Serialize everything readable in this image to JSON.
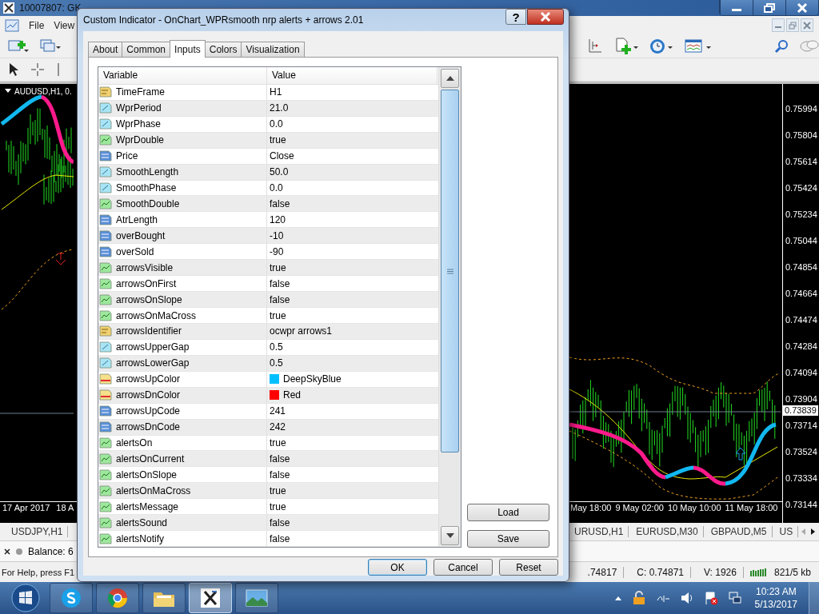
{
  "app_window": {
    "title": "10007807: GK",
    "menu": [
      "File",
      "View"
    ]
  },
  "left_chart": {
    "label": "AUDUSD,H1, 0.",
    "time_labels": [
      "17 Apr 2017",
      "18 A"
    ]
  },
  "right_chart": {
    "price_labels": [
      "0.75994",
      "0.75804",
      "0.75614",
      "0.75424",
      "0.75234",
      "0.75044",
      "0.74854",
      "0.74664",
      "0.74474",
      "0.74284",
      "0.74094",
      "0.73904",
      "0.73714",
      "0.73524",
      "0.73334",
      "0.73144"
    ],
    "current_price": "0.73839",
    "time_labels": [
      "May 18:00",
      "9 May 02:00",
      "10 May 10:00",
      "11 May 18:00"
    ]
  },
  "chart_tabs": {
    "left": [
      "USDJPY,H1"
    ],
    "right": [
      "URUSD,H1",
      "EURUSD,M30",
      "GBPAUD,M5",
      "US"
    ]
  },
  "terminal": {
    "text": "Balance: 6"
  },
  "status_bar": {
    "help": "For Help, press F1",
    "fields": [
      ".74817",
      "C: 0.74871",
      "V: 1926"
    ],
    "traffic": "821/5 kb"
  },
  "dialog": {
    "title": "Custom Indicator - OnChart_WPRsmooth nrp alerts + arrows 2.01",
    "help_button": "?",
    "tabs": [
      {
        "label": "About",
        "selected": false
      },
      {
        "label": "Common",
        "selected": false
      },
      {
        "label": "Inputs",
        "selected": true
      },
      {
        "label": "Colors",
        "selected": false
      },
      {
        "label": "Visualization",
        "selected": false
      }
    ],
    "columns": [
      "Variable",
      "Value"
    ],
    "rows": [
      {
        "kind": "string",
        "name": "TimeFrame",
        "value": "H1"
      },
      {
        "kind": "double",
        "name": "WprPeriod",
        "value": "21.0"
      },
      {
        "kind": "double",
        "name": "WprPhase",
        "value": "0.0"
      },
      {
        "kind": "bool",
        "name": "WprDouble",
        "value": "true"
      },
      {
        "kind": "int",
        "name": "Price",
        "value": "Close"
      },
      {
        "kind": "double",
        "name": "SmoothLength",
        "value": "50.0"
      },
      {
        "kind": "double",
        "name": "SmoothPhase",
        "value": "0.0"
      },
      {
        "kind": "bool",
        "name": "SmoothDouble",
        "value": "false"
      },
      {
        "kind": "int",
        "name": "AtrLength",
        "value": "120"
      },
      {
        "kind": "int",
        "name": "overBought",
        "value": "-10"
      },
      {
        "kind": "int",
        "name": "overSold",
        "value": "-90"
      },
      {
        "kind": "bool",
        "name": "arrowsVisible",
        "value": "true"
      },
      {
        "kind": "bool",
        "name": "arrowsOnFirst",
        "value": "false"
      },
      {
        "kind": "bool",
        "name": "arrowsOnSlope",
        "value": "false"
      },
      {
        "kind": "bool",
        "name": "arrowsOnMaCross",
        "value": "true"
      },
      {
        "kind": "string",
        "name": "arrowsIdentifier",
        "value": "ocwpr arrows1"
      },
      {
        "kind": "double",
        "name": "arrowsUpperGap",
        "value": "0.5"
      },
      {
        "kind": "double",
        "name": "arrowsLowerGap",
        "value": "0.5"
      },
      {
        "kind": "color",
        "name": "arrowsUpColor",
        "value": "DeepSkyBlue",
        "color": "#00bfff"
      },
      {
        "kind": "color",
        "name": "arrowsDnColor",
        "value": "Red",
        "color": "#ff0000"
      },
      {
        "kind": "int",
        "name": "arrowsUpCode",
        "value": "241"
      },
      {
        "kind": "int",
        "name": "arrowsDnCode",
        "value": "242"
      },
      {
        "kind": "bool",
        "name": "alertsOn",
        "value": "true"
      },
      {
        "kind": "bool",
        "name": "alertsOnCurrent",
        "value": "false"
      },
      {
        "kind": "bool",
        "name": "alertsOnSlope",
        "value": "false"
      },
      {
        "kind": "bool",
        "name": "alertsOnMaCross",
        "value": "true"
      },
      {
        "kind": "bool",
        "name": "alertsMessage",
        "value": "true"
      },
      {
        "kind": "bool",
        "name": "alertsSound",
        "value": "false"
      },
      {
        "kind": "bool",
        "name": "alertsNotify",
        "value": "false"
      }
    ],
    "side_buttons": [
      "Load",
      "Save"
    ],
    "buttons": [
      "OK",
      "Cancel",
      "Reset"
    ]
  },
  "taskbar": {
    "apps": [
      {
        "kind": "skype",
        "selected": false
      },
      {
        "kind": "browser",
        "selected": false
      },
      {
        "kind": "folder",
        "selected": false
      },
      {
        "kind": "trading",
        "selected": true
      },
      {
        "kind": "photo",
        "selected": false
      }
    ],
    "clock": {
      "time": "10:23 AM",
      "date": "5/13/2017"
    }
  }
}
